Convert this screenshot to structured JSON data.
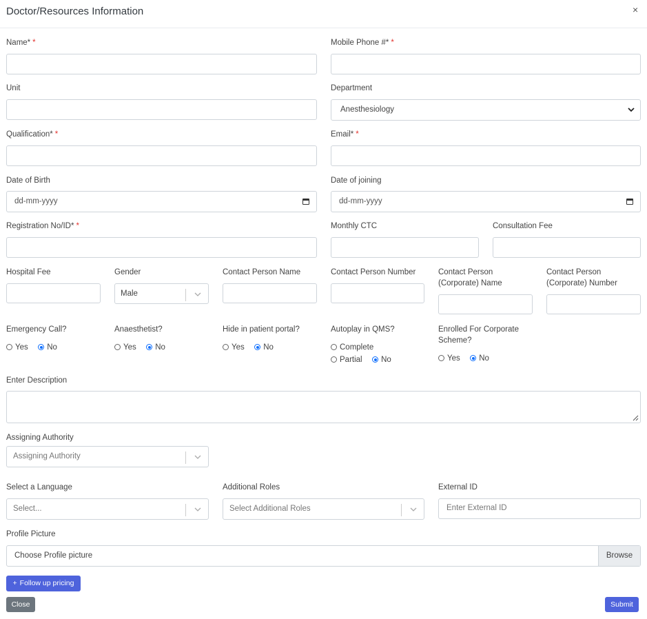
{
  "modal": {
    "title": "Doctor/Resources Information",
    "close_glyph": "×"
  },
  "fields": {
    "name": {
      "label": "Name*"
    },
    "mobile": {
      "label": "Mobile Phone #*"
    },
    "unit": {
      "label": "Unit"
    },
    "department": {
      "label": "Department",
      "value": "Anesthesiology"
    },
    "qualification": {
      "label": "Qualification*"
    },
    "email": {
      "label": "Email*"
    },
    "dob": {
      "label": "Date of Birth",
      "placeholder": "dd-mm-yyyy"
    },
    "doj": {
      "label": "Date of joining",
      "placeholder": "dd-mm-yyyy"
    },
    "registration": {
      "label": "Registration No/ID*"
    },
    "ctc": {
      "label": "Monthly CTC"
    },
    "consultation_fee": {
      "label": "Consultation Fee"
    },
    "hospital_fee": {
      "label": "Hospital Fee"
    },
    "gender": {
      "label": "Gender",
      "value": "Male"
    },
    "contact_name": {
      "label": "Contact Person Name"
    },
    "contact_number": {
      "label": "Contact Person Number"
    },
    "corp_name": {
      "label_line1": "Contact Person",
      "label_line2": "(Corporate) Name"
    },
    "corp_number": {
      "label_line1": "Contact Person",
      "label_line2": "(Corporate) Number"
    },
    "description": {
      "label": "Enter Description"
    },
    "assigning_authority": {
      "label": "Assigning Authority",
      "placeholder": "Assigning Authority"
    },
    "language": {
      "label": "Select a Language",
      "placeholder": "Select..."
    },
    "additional_roles": {
      "label": "Additional Roles",
      "placeholder": "Select Additional Roles"
    },
    "external_id": {
      "label": "External ID",
      "placeholder": "Enter External ID"
    },
    "profile_picture": {
      "label": "Profile Picture",
      "placeholder": "Choose Profile picture",
      "browse": "Browse"
    }
  },
  "radios": {
    "emergency": {
      "label": "Emergency Call?",
      "yes": "Yes",
      "no": "No",
      "selected": "no"
    },
    "anaesthetist": {
      "label": "Anaesthetist?",
      "yes": "Yes",
      "no": "No",
      "selected": "no"
    },
    "hide_portal": {
      "label": "Hide in patient portal?",
      "yes": "Yes",
      "no": "No",
      "selected": "no"
    },
    "autoplay": {
      "label": "Autoplay in QMS?",
      "complete": "Complete",
      "partial": "Partial",
      "no": "No",
      "selected": "no"
    },
    "corporate": {
      "label_line1": "Enrolled For Corporate",
      "label_line2": "Scheme?",
      "yes": "Yes",
      "no": "No",
      "selected": "no"
    }
  },
  "required_mark": "*",
  "buttons": {
    "follow_up": "Follow up pricing",
    "follow_up_glyph": "+",
    "close": "Close",
    "submit": "Submit"
  },
  "colors": {
    "primary": "#4e73df",
    "secondary": "#6c757d",
    "required": "#e3342f",
    "radio_checked": "#0d6efd"
  }
}
